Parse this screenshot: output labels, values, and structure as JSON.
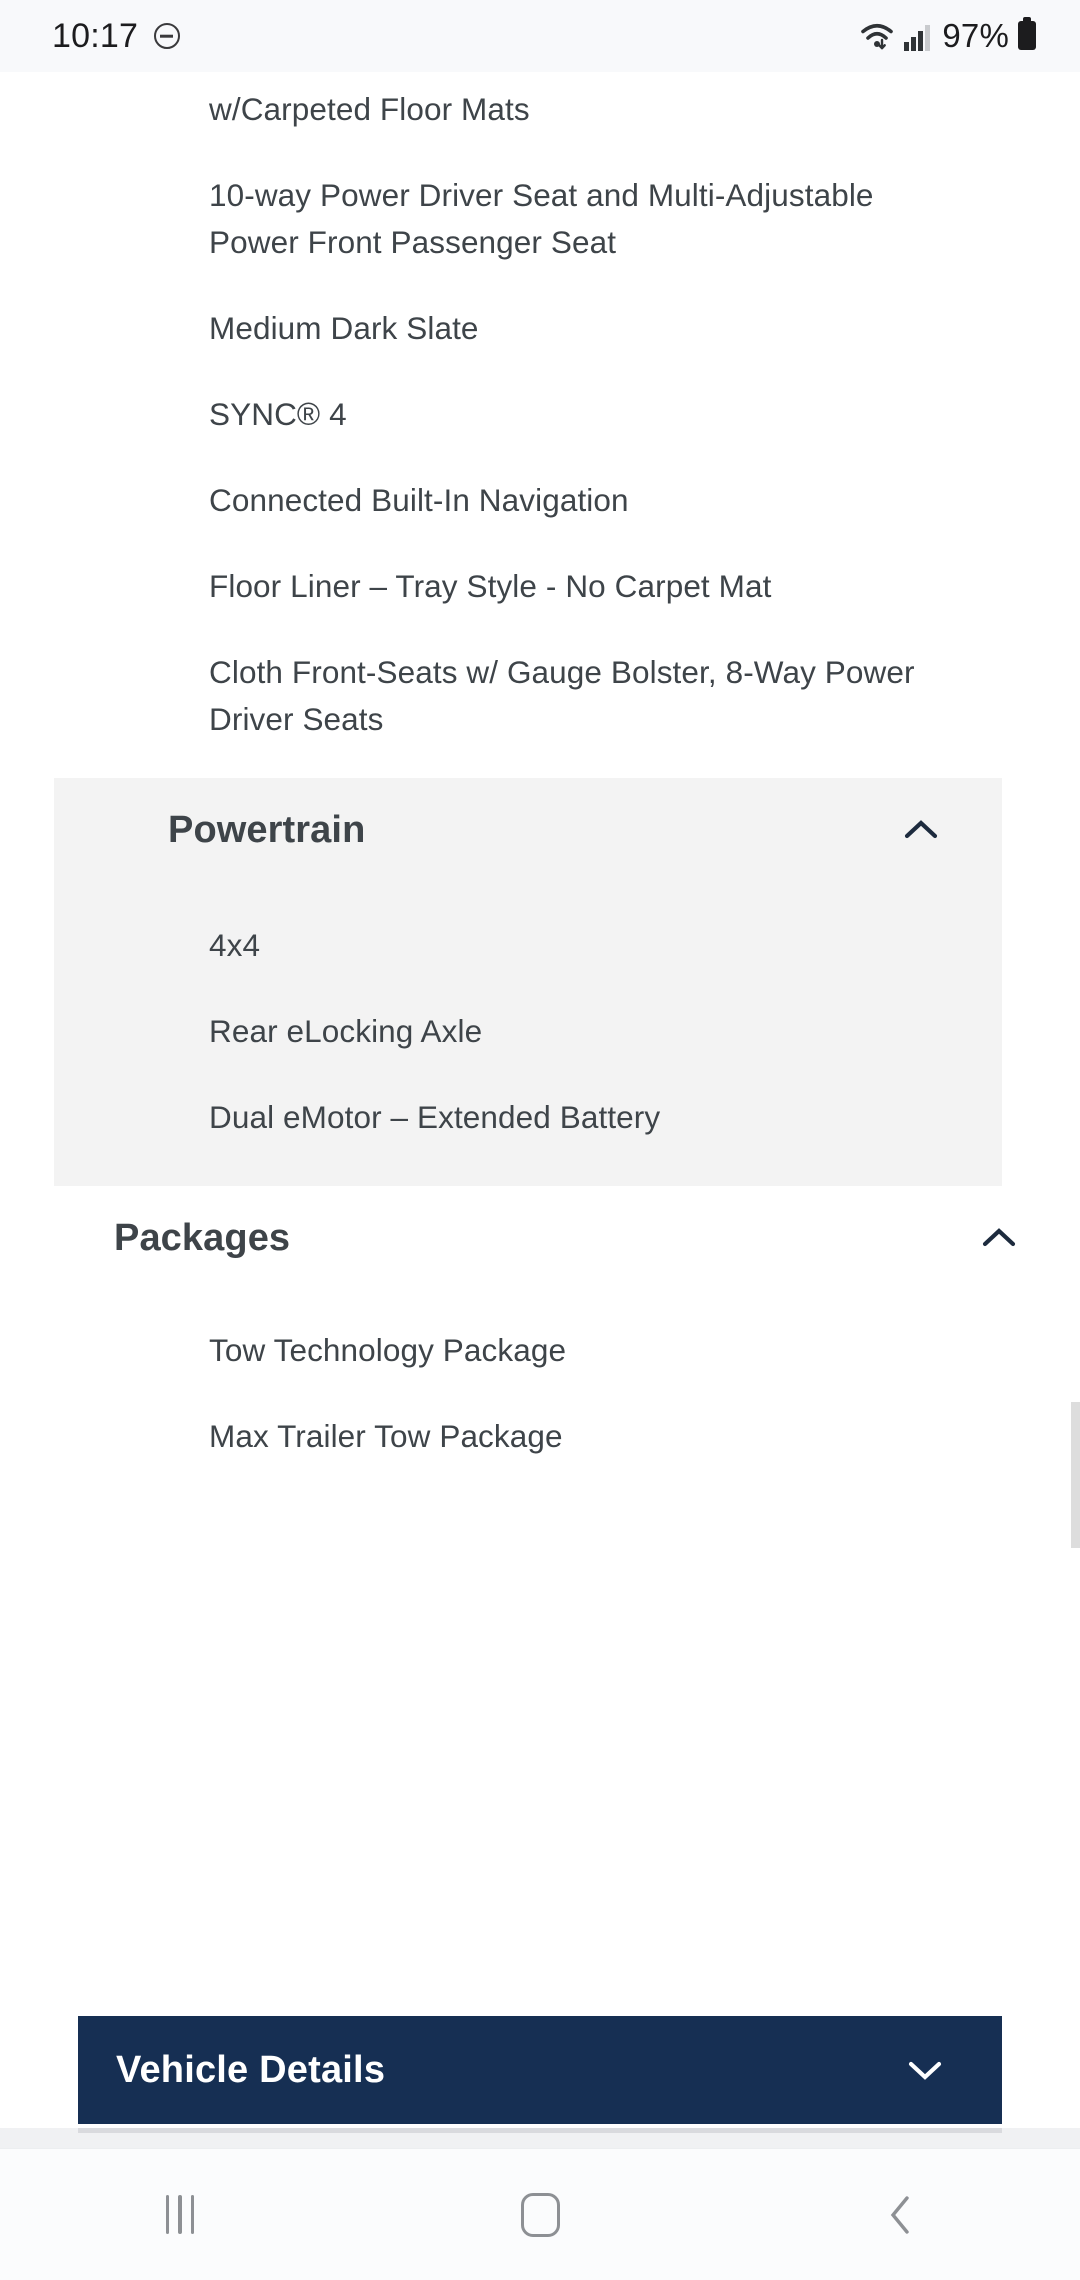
{
  "status_bar": {
    "time": "10:17",
    "dnd_icon": "do-not-disturb-icon",
    "wifi_icon": "wifi-icon",
    "signal_icon": "cellular-signal-icon",
    "battery_percent": "97%",
    "battery_icon": "battery-icon"
  },
  "features": {
    "top_partial_item": "w/Carpeted Floor Mats",
    "items": [
      "10-way Power Driver Seat and Multi-Adjustable Power Front Passenger Seat",
      "Medium Dark Slate",
      "SYNC® 4",
      "Connected Built-In Navigation",
      "Floor Liner – Tray Style - No Carpet Mat",
      "Cloth Front-Seats w/ Gauge Bolster, 8-Way Power Driver Seats"
    ]
  },
  "sections": [
    {
      "title": "Powertrain",
      "chevron": "chevron-up-icon",
      "expanded": true,
      "items": [
        "4x4",
        "Rear eLocking Axle",
        "Dual eMotor – Extended Battery"
      ]
    },
    {
      "title": "Packages",
      "chevron": "chevron-up-icon",
      "expanded": true,
      "items": [
        "Tow Technology Package",
        "Max Trailer Tow Package"
      ]
    }
  ],
  "vehicle_details": {
    "label": "Vehicle Details",
    "chevron": "chevron-down-icon"
  },
  "nav_bar": {
    "recents_label": "recents-icon",
    "home_label": "home-icon",
    "back_label": "back-icon"
  },
  "colors": {
    "accent_navy": "#162f53",
    "panel_gray": "#f3f3f3",
    "text_gray": "#3e4449",
    "status_bg": "#f8f9fb"
  }
}
